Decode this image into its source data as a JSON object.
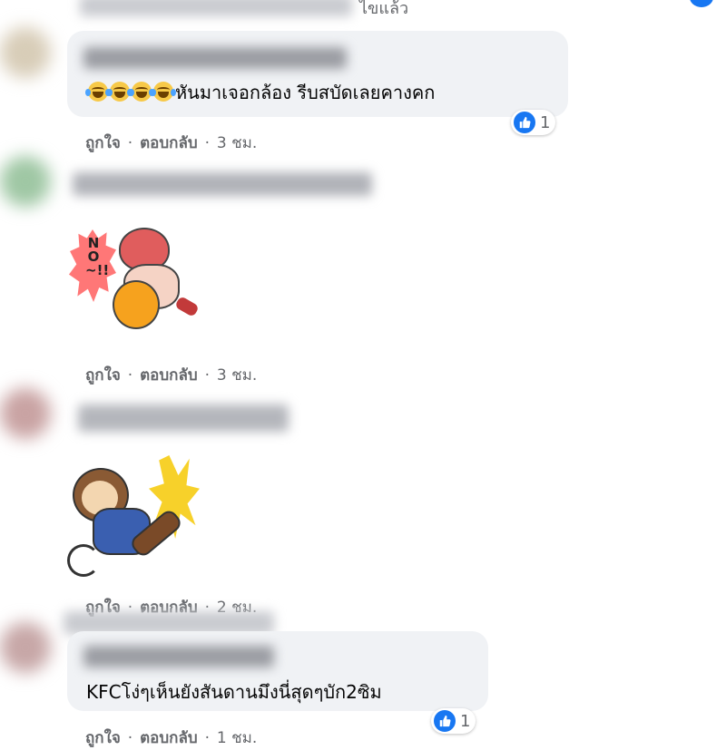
{
  "top_fragment": "ไขแล้ว",
  "actions": {
    "like": "ถูกใจ",
    "reply": "ตอบกลับ",
    "dot": "·"
  },
  "comments": [
    {
      "emoji_count": 4,
      "emoji_icon": "face-with-tears-of-joy-icon",
      "text": "หันมาเจอกล้อง รีบสบัดเลยคางคก",
      "time": "3 ชม.",
      "reaction_count": "1"
    },
    {
      "sticker": "no-sticker",
      "sticker_text": "NO~!!",
      "time": "3 ชม."
    },
    {
      "sticker": "monkey-kick-sticker",
      "time": "2 ชม."
    },
    {
      "text": "KFCโง่ๆเห็นยังสันดานมึงนี่สุดๆบัก2ซิม",
      "time": "1 ชม.",
      "reaction_count": "1"
    }
  ],
  "colors": {
    "like_blue": "#1877f2",
    "bubble_bg": "#f0f2f5",
    "meta_gray": "#65676b"
  }
}
